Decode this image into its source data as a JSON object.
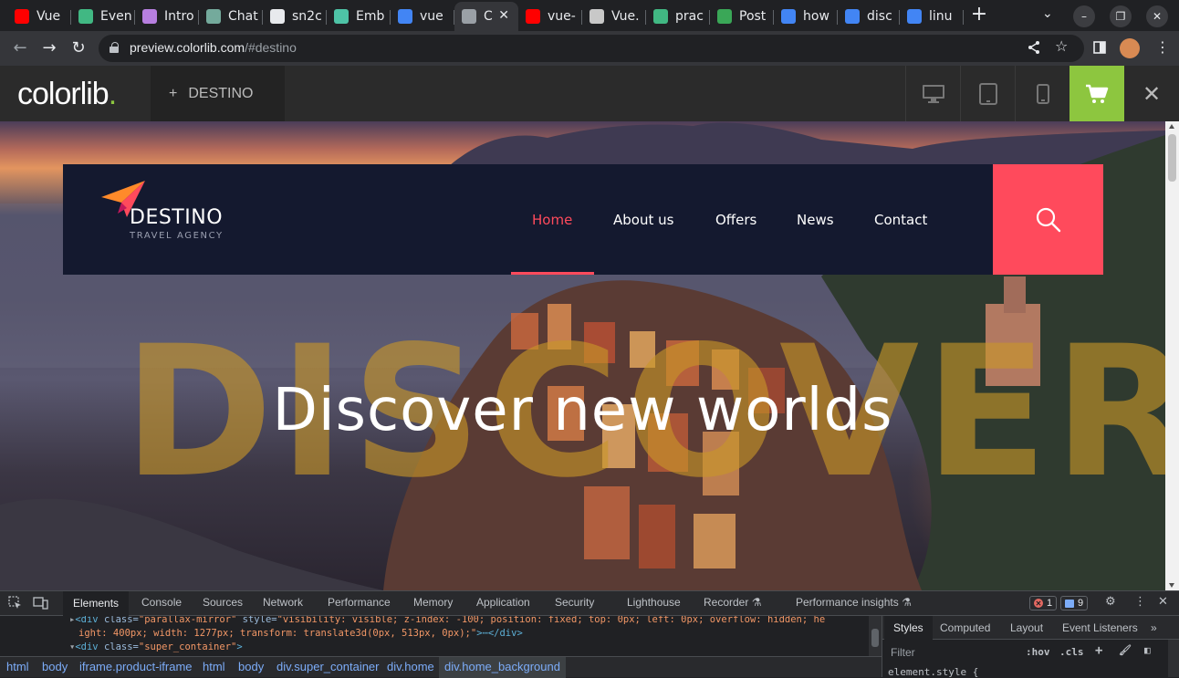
{
  "browser": {
    "tabs": [
      {
        "title": "Vue",
        "icon": "youtube-icon",
        "color": "#ff0000"
      },
      {
        "title": "Even",
        "icon": "vue-icon",
        "color": "#41b883"
      },
      {
        "title": "Intro",
        "icon": "spiral-icon",
        "color": "#b77fe0"
      },
      {
        "title": "Chat",
        "icon": "chatgpt-icon",
        "color": "#74aa9c"
      },
      {
        "title": "sn2c",
        "icon": "github-icon",
        "color": "#e8eaed"
      },
      {
        "title": "Emb",
        "icon": "bootstrap-icon",
        "color": "#4ec3a6"
      },
      {
        "title": "vue",
        "icon": "google-icon",
        "color": "#4285f4"
      },
      {
        "title": "C",
        "icon": "globe-icon",
        "color": "#9aa0a6"
      },
      {
        "title": "vue-",
        "icon": "youtube-icon",
        "color": "#ff0000"
      },
      {
        "title": "Vue.",
        "icon": "avatar-icon",
        "color": "#c8c8c8"
      },
      {
        "title": "prac",
        "icon": "vue-icon",
        "color": "#41b883"
      },
      {
        "title": "Post",
        "icon": "tree-icon",
        "color": "#3aa757"
      },
      {
        "title": "how",
        "icon": "google-icon",
        "color": "#4285f4"
      },
      {
        "title": "disc",
        "icon": "google-icon",
        "color": "#4285f4"
      },
      {
        "title": "linu",
        "icon": "google-icon",
        "color": "#4285f4"
      }
    ],
    "active_tab_index": 7,
    "new_tab_symbol": "+",
    "url_host": "preview.colorlib.com",
    "url_rest": "/#destino"
  },
  "colorlib": {
    "logo": "colorlib",
    "logo_dot": ".",
    "theme_plus": "+",
    "theme_name": "DESTINO",
    "close_symbol": "✕",
    "accent": "#8dc63f"
  },
  "site": {
    "brand_name": "DESTINO",
    "brand_tagline": "TRAVEL AGENCY",
    "menu": [
      {
        "label": "Home",
        "active": true
      },
      {
        "label": "About us",
        "active": false
      },
      {
        "label": "Offers",
        "active": false
      },
      {
        "label": "News",
        "active": false
      },
      {
        "label": "Contact",
        "active": false
      }
    ],
    "background_word": "DISCOVER",
    "headline": "Discover new worlds",
    "accent": "#ff4a5c",
    "nav_bg": "#14192f"
  },
  "devtools": {
    "tabs": [
      "Elements",
      "Console",
      "Sources",
      "Network",
      "Performance",
      "Memory",
      "Application",
      "Security",
      "Lighthouse",
      "Recorder",
      "Performance insights"
    ],
    "active_tab": "Elements",
    "errors": "1",
    "messages": "9",
    "code": {
      "line1_tag_open": "<div ",
      "line1_attr": "class=",
      "line1_val": "\"parallax-mirror\"",
      "line1_attr2": " style=",
      "line1_val2": "\"visibility: visible; z-index: -100; position: fixed; top: 0px; left: 0px; overflow: hidden; he",
      "line2_val": "ight: 400px; width: 1277px; transform: translate3d(0px, 513px, 0px);\"",
      "line2_tail": ">⋯</div>",
      "line3_tag_open": "<div ",
      "line3_attr": "class=",
      "line3_val": "\"super_container\"",
      "line3_tail": ">"
    },
    "breadcrumbs": [
      "html",
      "body",
      "iframe.product-iframe",
      "html",
      "body",
      "div.super_container",
      "div.home",
      "div.home_background"
    ],
    "styles_tabs": [
      "Styles",
      "Computed",
      "Layout",
      "Event Listeners",
      "»"
    ],
    "filter_placeholder": "Filter",
    "hov": ":hov",
    "cls": ".cls",
    "element_style": "element.style {"
  }
}
